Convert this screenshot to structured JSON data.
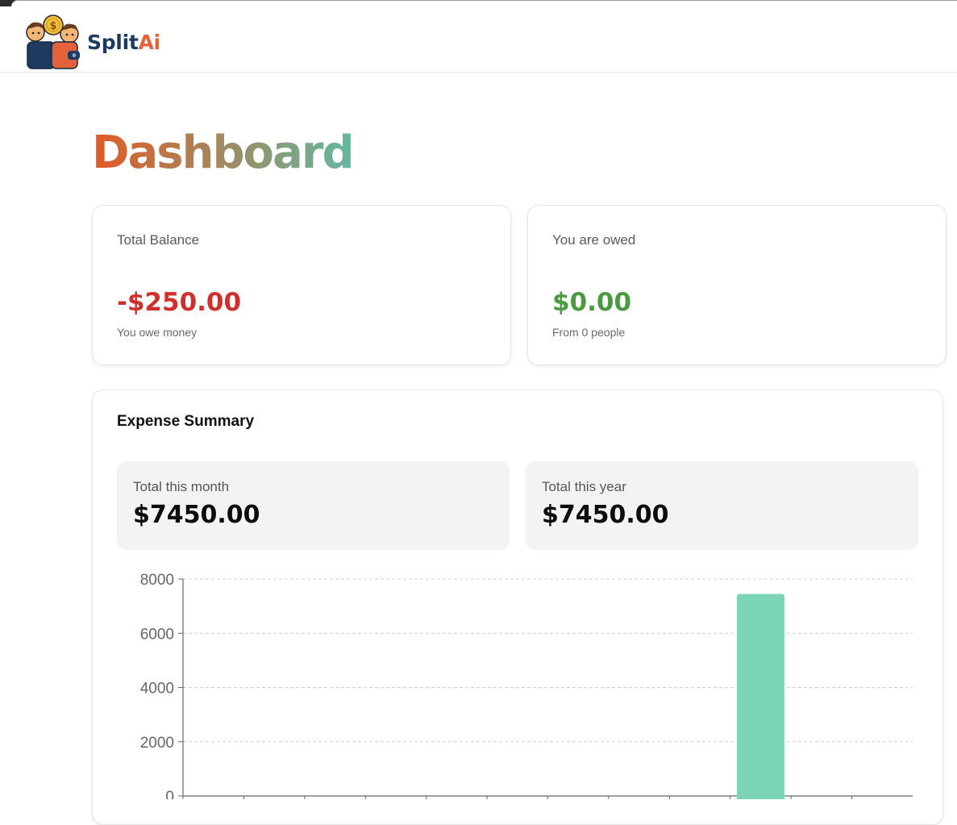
{
  "app": {
    "logo_split": "Split",
    "logo_ai": "Ai"
  },
  "page": {
    "title": "Dashboard"
  },
  "balance_card": {
    "label": "Total Balance",
    "amount": "-$250.00",
    "subtext": "You owe money",
    "amount_color": "#d0302b"
  },
  "owed_card": {
    "label": "You are owed",
    "amount": "$0.00",
    "subtext": "From 0 people",
    "amount_color": "#4a9a3f"
  },
  "expense_summary": {
    "title": "Expense Summary",
    "month": {
      "label": "Total this month",
      "value": "$7450.00"
    },
    "year": {
      "label": "Total this year",
      "value": "$7450.00"
    }
  },
  "chart_data": {
    "type": "bar",
    "categories": [
      "",
      "",
      "",
      "",
      "",
      "",
      "",
      "",
      "",
      "",
      "",
      ""
    ],
    "values": [
      0,
      0,
      0,
      0,
      0,
      0,
      0,
      0,
      0,
      7450,
      0,
      0
    ],
    "ylim": [
      0,
      8000
    ],
    "yticks": [
      "0",
      "2000",
      "4000",
      "6000",
      "8000"
    ],
    "grid": true,
    "bar_color": "#7bd3b8",
    "xlabel": "",
    "ylabel": ""
  }
}
